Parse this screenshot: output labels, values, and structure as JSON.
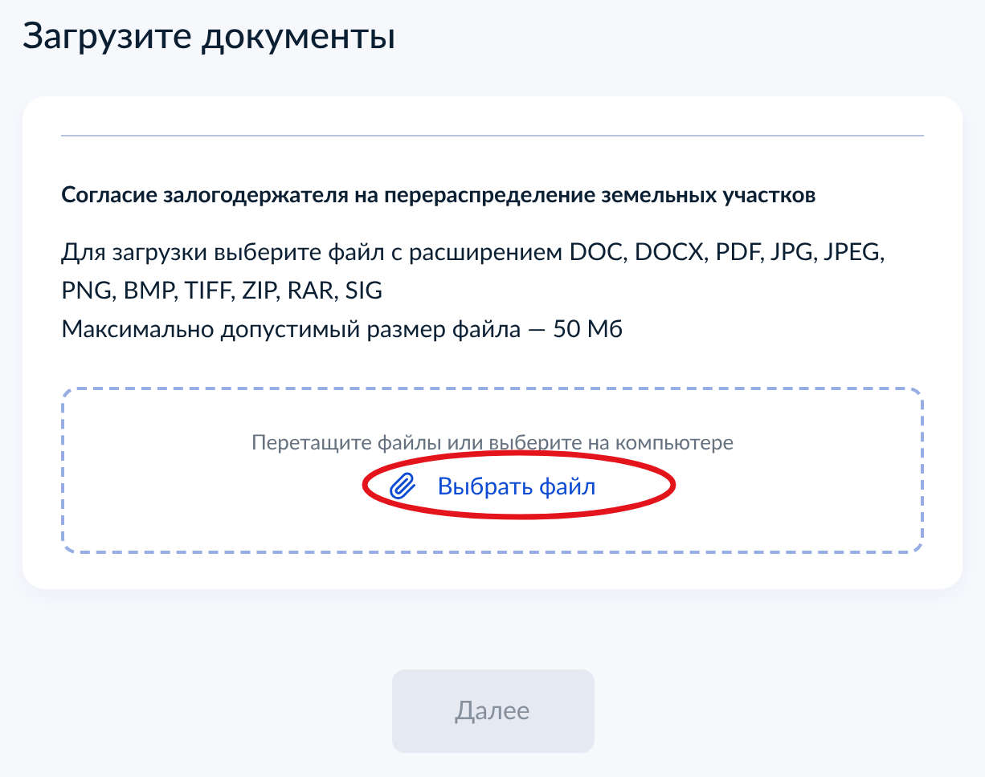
{
  "title": "Загрузите документы",
  "document": {
    "name": "Согласие залогодержателя на перераспределение земельных участков",
    "description_lines": [
      "Для загрузки выберите файл с расширением DOC, DOCX, PDF, JPG, JPEG, PNG, BMP, TIFF, ZIP, RAR, SIG",
      "Максимально допустимый размер файла — 50 Мб"
    ]
  },
  "upload": {
    "hint": "Перетащите файлы или выберите на компьютере",
    "link": {
      "label": "Выбрать файл",
      "highlighted": true
    }
  },
  "next_button": {
    "label": "Далее",
    "disabled": true
  }
}
